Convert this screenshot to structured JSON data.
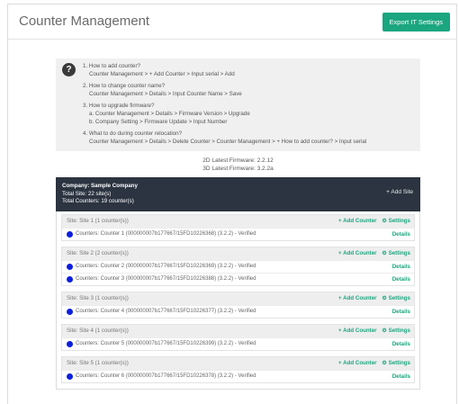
{
  "header": {
    "title": "Counter Management",
    "export_label": "Export IT Settings"
  },
  "faq": {
    "items": [
      {
        "q": "1. How to add counter?",
        "a": [
          "Counter Management > + Add Counter > Input serial > Add"
        ]
      },
      {
        "q": "2. How to change counter name?",
        "a": [
          "Counter Management > Details > Input Counter Name > Save"
        ]
      },
      {
        "q": "3. How to upgrade firmware?",
        "a": [
          "a. Counter Management > Details > Firmware Version > Upgrade",
          "b. Company Setting > Firmware Update > Input Number"
        ]
      },
      {
        "q": "4. What to do during counter relocation?",
        "a": [
          "Counter Management > Details > Delete Counter > Counter Management > + How to add counter? > Input serial"
        ]
      }
    ]
  },
  "firmware": {
    "line1": "2D Latest Firmware: 2.2.12",
    "line2": "3D Latest Firmware: 3.2.2a"
  },
  "company": {
    "name": "Company: Sample Company",
    "total_site": "Total Site: 22 site(s)",
    "total_counters": "Total Counters: 19 counter(s)",
    "add_site": "+ Add Site"
  },
  "labels": {
    "add_counter": "+ Add Counter",
    "settings": "⚙ Settings",
    "details": "Details"
  },
  "sites": [
    {
      "label": "Site: Site 1 (1 counter(s))",
      "counters": [
        "Counters: Counter 1 (000000007b177667/15FD10226368) (3.2.2) - Verified"
      ]
    },
    {
      "label": "Site: Site 2 (2 counter(s))",
      "counters": [
        "Counters: Counter 2 (000000007b177667/15FD10226369) (3.2.2) - Verified",
        "Counters: Counter 3 (000000007b177667/15FD10226388) (3.2.2) - Verified"
      ]
    },
    {
      "label": "Site: Site 3 (1 counter(s))",
      "counters": [
        "Counters: Counter 4 (000000007b177667/15FD10226377) (3.2.2) - Verified"
      ]
    },
    {
      "label": "Site: Site 4 (1 counter(s))",
      "counters": [
        "Counters: Counter 5 (000000007b177667/15FD10226399) (3.2.2) - Verified"
      ]
    },
    {
      "label": "Site: Site 5 (1 counter(s))",
      "counters": [
        "Counters: Counter 6 (000000007b177667/15FD10226378) (3.2.2) - Verified"
      ]
    }
  ],
  "colors": {
    "accent": "#1aa67f",
    "company_bar": "#2b3440",
    "status_dot": "#0c1fe0"
  }
}
